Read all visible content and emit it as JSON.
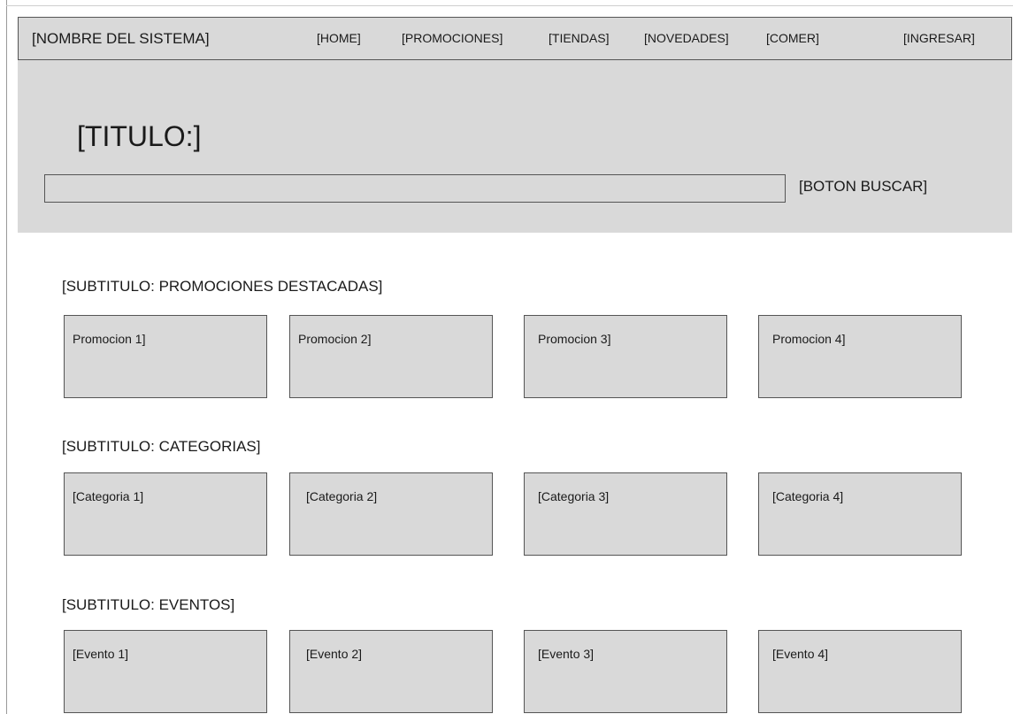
{
  "navbar": {
    "brand": "[NOMBRE DEL SISTEMA]",
    "links": [
      "[HOME]",
      "[PROMOCIONES]",
      "[TIENDAS]",
      "[NOVEDADES]",
      "[COMER]"
    ],
    "login": "[INGRESAR]"
  },
  "hero": {
    "title": "[TITULO:]",
    "search_value": "",
    "search_button": "[BOTON BUSCAR]"
  },
  "sections": [
    {
      "subtitle": "[SUBTITULO: PROMOCIONES DESTACADAS]",
      "cards": [
        "Promocion 1]",
        "Promocion 2]",
        "Promocion 3]",
        "Promocion 4]"
      ]
    },
    {
      "subtitle": "[SUBTITULO: CATEGORIAS]",
      "cards": [
        "[Categoria 1]",
        "[Categoria 2]",
        "[Categoria 3]",
        "[Categoria 4]"
      ]
    },
    {
      "subtitle": "[SUBTITULO: EVENTOS]",
      "cards": [
        "[Evento 1]",
        "[Evento 2]",
        "[Evento 3]",
        "[Evento 4]"
      ]
    }
  ],
  "colors": {
    "panel": "#d9d9d9",
    "border": "#555555",
    "text": "#1a1a1a"
  }
}
